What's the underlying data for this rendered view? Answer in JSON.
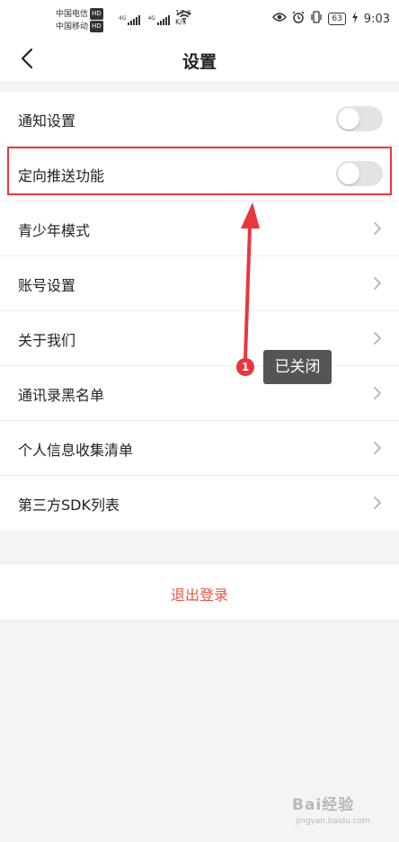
{
  "status_bar": {
    "carrier_1": "中国电信",
    "carrier_2": "中国移动",
    "hd_badge": "HD",
    "net_type": "4G",
    "speed_value": "17.6",
    "speed_unit": "K/s",
    "battery": "63",
    "time": "9:03",
    "icons": [
      "eye-icon",
      "alarm-icon",
      "vibrate-icon",
      "battery-icon",
      "charging-icon",
      "wifi-icon",
      "signal-icon"
    ]
  },
  "header": {
    "title": "设置",
    "back_icon": "chevron-left-icon"
  },
  "settings": {
    "items": [
      {
        "label": "通知设置",
        "control": "toggle",
        "on": false
      },
      {
        "label": "定向推送功能",
        "control": "toggle",
        "on": false
      },
      {
        "label": "青少年模式",
        "control": "chevron"
      },
      {
        "label": "账号设置",
        "control": "chevron"
      },
      {
        "label": "关于我们",
        "control": "chevron"
      },
      {
        "label": "通讯录黑名单",
        "control": "chevron"
      },
      {
        "label": "个人信息收集清单",
        "control": "chevron"
      },
      {
        "label": "第三方SDK列表",
        "control": "chevron"
      }
    ]
  },
  "logout": {
    "label": "退出登录"
  },
  "annotation": {
    "step": "1",
    "tooltip": "已关闭",
    "color": "#e8373d"
  },
  "watermark": {
    "main": "Bai经验",
    "sub": "jingyan.baidu.com"
  },
  "colors": {
    "accent_red": "#e8373d",
    "logout_text": "#ee5544",
    "toggle_off": "#e3e3e3",
    "background": "#f4f4f4"
  }
}
